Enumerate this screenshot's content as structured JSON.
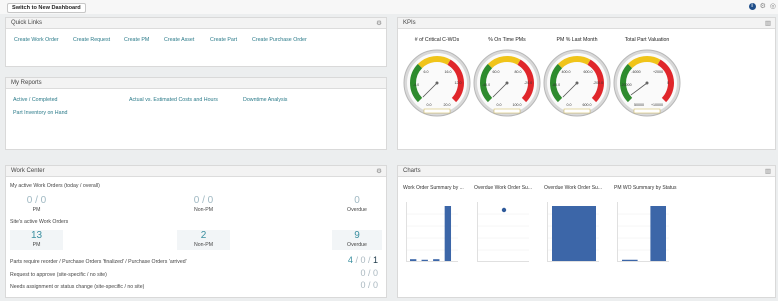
{
  "topbar": {
    "switch_label": "Switch to New Dashboard",
    "info_icon": "info-icon",
    "settings_icon": "gear-icon"
  },
  "quick_links": {
    "title": "Quick Links",
    "links": [
      "Create Work Order",
      "Create Request",
      "Create PM",
      "Create Asset",
      "Create Part",
      "Create Purchase Order"
    ]
  },
  "my_reports": {
    "title": "My Reports",
    "links": [
      "Active / Completed",
      "Actual vs. Estimated Costs and Hours",
      "Downtime Analysis",
      "Part Inventory on Hand"
    ]
  },
  "kpis": {
    "title": "KPIs",
    "gauges": [
      {
        "title": "# of Critical C-WOs",
        "ticks": [
          "-4.0",
          "6.0",
          "16.0",
          "12.0",
          "0.0",
          "20.0"
        ],
        "needle": 0.0,
        "min": 0,
        "max": 20
      },
      {
        "title": "% On Time PMs",
        "ticks": [
          "-40.0",
          "60.0",
          "80.0",
          "-20.0",
          "0.0",
          "100.0"
        ],
        "needle": 0.0,
        "min": 0,
        "max": 100
      },
      {
        "title": "PM % Last Month",
        "ticks": [
          "-80.0",
          "400.0",
          "600.0",
          "-200.0",
          "0.0",
          "600.0"
        ],
        "needle": 0.0,
        "min": 0,
        "max": 600
      },
      {
        "title": "Total Part Valuation",
        "ticks": [
          "-20000",
          "-6000",
          "+2000",
          "0",
          "50000",
          "+10000"
        ],
        "needle": 1540,
        "min": 0,
        "max": 50000
      }
    ]
  },
  "work_center": {
    "title": "Work Center",
    "my_active_label": "My active Work Orders (today / overall)",
    "my_active": [
      {
        "value": "0 / 0",
        "label": "PM"
      },
      {
        "value": "0 / 0",
        "label": "Non-PM"
      },
      {
        "value": "0",
        "label": "Overdue"
      }
    ],
    "site_active_label": "Site's active Work Orders",
    "site_active": [
      {
        "value": "13",
        "label": "PM"
      },
      {
        "value": "2",
        "label": "Non-PM"
      },
      {
        "value": "9",
        "label": "Overdue"
      }
    ],
    "rows": [
      {
        "label": "Parts require reorder / Purchase Orders 'finalized' / Purchase Orders 'arrived'",
        "a": "4",
        "b": "0",
        "c": "1"
      },
      {
        "label": "Request to approve (site-specific / no site)",
        "a": "0",
        "b": "0"
      },
      {
        "label": "Needs assignment or status change (site-specific / no site)",
        "a": "0",
        "b": "0"
      }
    ]
  },
  "charts": {
    "title": "Charts",
    "chart_data": [
      {
        "type": "bar",
        "title": "Work Order Summary by ...",
        "values": [
          0.05,
          0.04,
          0.05,
          1
        ]
      },
      {
        "type": "scatter",
        "title": "Overdue Work Order Su...",
        "values": [
          1
        ]
      },
      {
        "type": "bar",
        "title": "Overdue Work Order Su...",
        "values": [
          1
        ]
      },
      {
        "type": "bar",
        "title": "PM WO Summary by Status",
        "values": [
          0.04,
          1
        ]
      }
    ]
  }
}
